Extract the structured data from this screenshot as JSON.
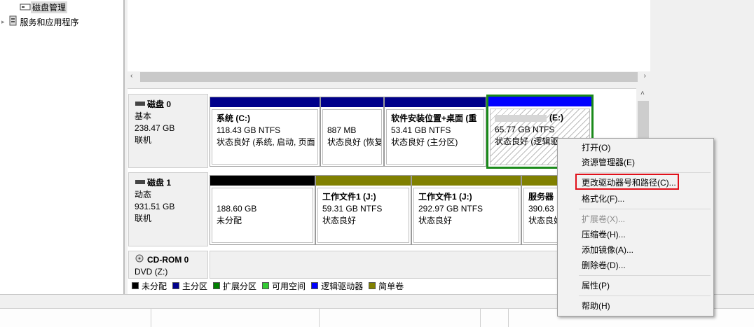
{
  "tree": {
    "disk_mgmt": "磁盘管理",
    "services": "服务和应用程序"
  },
  "disks": [
    {
      "name": "磁盘 0",
      "type": "基本",
      "size": "238.47 GB",
      "status": "联机"
    },
    {
      "name": "磁盘 1",
      "type": "动态",
      "size": "931.51 GB",
      "status": "联机"
    },
    {
      "name": "CD-ROM 0",
      "type": "DVD (Z:)"
    }
  ],
  "disk0_parts": [
    {
      "title": "系统  (C:)",
      "size": "118.43 GB NTFS",
      "status": "状态良好 (系统, 启动, 页面"
    },
    {
      "title": "",
      "size": "887 MB",
      "status": "状态良好 (恢复"
    },
    {
      "title": "软件安装位置+桌面  (重",
      "size": "53.41 GB NTFS",
      "status": "状态良好 (主分区)"
    },
    {
      "title": "(E:)",
      "size": "65.77 GB NTFS",
      "status": "状态良好 (逻辑驱"
    }
  ],
  "disk1_parts": [
    {
      "title": "",
      "size": "188.60 GB",
      "status": "未分配"
    },
    {
      "title": "工作文件1  (J:)",
      "size": "59.31 GB NTFS",
      "status": "状态良好"
    },
    {
      "title": "工作文件1  (J:)",
      "size": "292.97 GB NTFS",
      "status": "状态良好"
    },
    {
      "title": "服务器",
      "size": "390.63",
      "status": "状态良好"
    }
  ],
  "legend": [
    {
      "label": "未分配",
      "color": "#000000"
    },
    {
      "label": "主分区",
      "color": "#00008b"
    },
    {
      "label": "扩展分区",
      "color": "#008000"
    },
    {
      "label": "可用空间",
      "color": "#33cc33"
    },
    {
      "label": "逻辑驱动器",
      "color": "#0000ff"
    },
    {
      "label": "简单卷",
      "color": "#808000"
    }
  ],
  "menu": {
    "open": "打开(O)",
    "explorer": "资源管理器(E)",
    "change_letter": "更改驱动器号和路径(C)...",
    "format": "格式化(F)...",
    "extend": "扩展卷(X)...",
    "shrink": "压缩卷(H)...",
    "mirror": "添加镜像(A)...",
    "delete": "删除卷(D)...",
    "properties": "属性(P)",
    "help": "帮助(H)"
  },
  "colors": {
    "primary": "#00008b",
    "logical": "#0000ff",
    "simple": "#808000",
    "unallocated": "#000000",
    "extended": "#008000",
    "highlight": "#e0101a"
  }
}
